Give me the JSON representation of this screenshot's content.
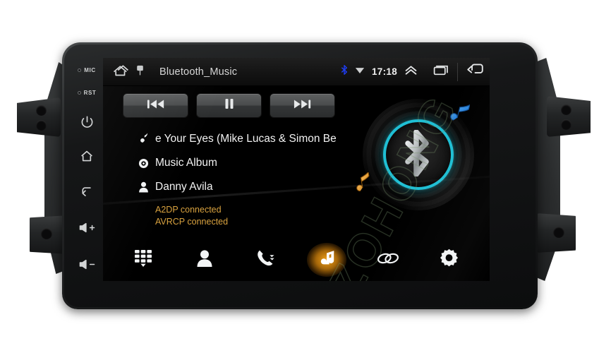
{
  "device": {
    "bezel_keys": [
      {
        "id": "mic",
        "label": "MIC",
        "icon": "mic-led"
      },
      {
        "id": "rst",
        "label": "RST",
        "icon": "reset-led"
      },
      {
        "id": "power",
        "label": "",
        "icon": "power-icon"
      },
      {
        "id": "home",
        "label": "",
        "icon": "home-icon"
      },
      {
        "id": "back",
        "label": "",
        "icon": "back-arrow-icon"
      },
      {
        "id": "vol-up",
        "label": "+",
        "icon": "volume-up-icon"
      },
      {
        "id": "vol-down",
        "label": "-",
        "icon": "volume-down-icon"
      }
    ],
    "watermark": "ZOHONG"
  },
  "statusbar": {
    "home_icon": "home-app-icon",
    "screenshot_icon": "screenshot-icon",
    "title": "Bluetooth_Music",
    "bluetooth_icon": "bluetooth-icon",
    "signal_icon": "wifi-signal-icon",
    "time": "17:18",
    "expand_icon": "chevron-up-icon",
    "recents_icon": "recent-apps-icon",
    "back_icon": "back-icon",
    "bluetooth_color": "#1f3df0"
  },
  "player": {
    "transport": [
      {
        "id": "previous",
        "icon": "previous-track-icon",
        "label": "Previous"
      },
      {
        "id": "pause",
        "icon": "pause-icon",
        "label": "Pause"
      },
      {
        "id": "next",
        "icon": "next-track-icon",
        "label": "Next"
      }
    ],
    "meta": [
      {
        "id": "track",
        "icon": "music-note-icon",
        "value": "e Your Eyes (Mike Lucas & Simon Be"
      },
      {
        "id": "album",
        "icon": "album-disc-icon",
        "value": "Music Album"
      },
      {
        "id": "artist",
        "icon": "artist-person-icon",
        "value": "Danny Avila"
      }
    ],
    "statuses": [
      {
        "id": "a2dp",
        "text": "A2DP connected"
      },
      {
        "id": "avrcp",
        "text": "AVRCP connected"
      }
    ],
    "status_color": "#d9a23f",
    "art": {
      "vinyl_label": "vinyl-record",
      "bluetooth_logo": "bluetooth-logo-icon",
      "ring_color": "#1fbfd4",
      "note_blue_color": "#2e86de",
      "note_orange_color": "#e8a33d"
    }
  },
  "navbar": {
    "items": [
      {
        "id": "dialpad",
        "icon": "dialpad-icon",
        "label": "Dialpad",
        "active": false
      },
      {
        "id": "contacts",
        "icon": "contacts-icon",
        "label": "Contacts",
        "active": false
      },
      {
        "id": "calllog",
        "icon": "call-log-icon",
        "label": "Call Log",
        "active": false
      },
      {
        "id": "music",
        "icon": "music-icon",
        "label": "Music",
        "active": true
      },
      {
        "id": "pair",
        "icon": "link-chain-icon",
        "label": "Pair",
        "active": false
      },
      {
        "id": "settings",
        "icon": "gear-icon",
        "label": "Settings",
        "active": false
      }
    ],
    "active_glow_color": "#f2a21a"
  }
}
